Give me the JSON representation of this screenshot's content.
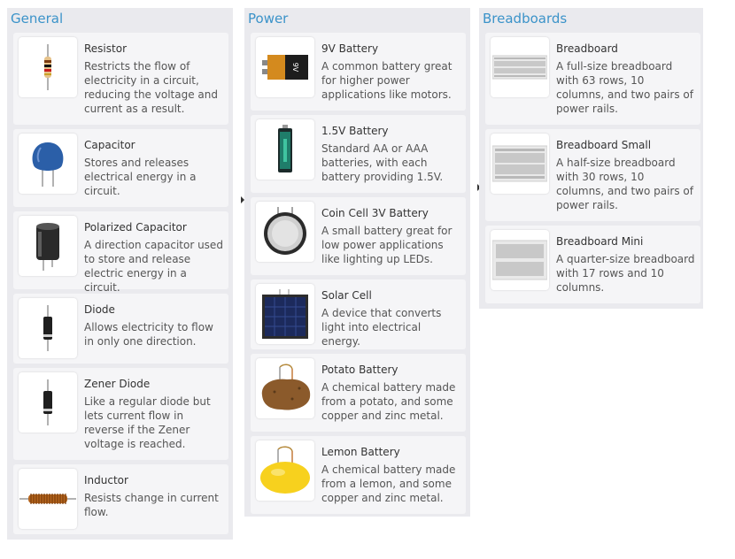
{
  "general": {
    "title": "General",
    "items": [
      {
        "icon": "resistor-icon",
        "title": "Resistor",
        "desc": "Restricts the flow of electricity in a circuit, reducing the voltage and current as a result."
      },
      {
        "icon": "capacitor-icon",
        "title": "Capacitor",
        "desc": "Stores and releases electrical energy in a circuit."
      },
      {
        "icon": "polarized-capacitor-icon",
        "title": "Polarized Capacitor",
        "desc": "A direction capacitor used to store and release electric energy in a circuit."
      },
      {
        "icon": "diode-icon",
        "title": "Diode",
        "desc": "Allows electricity to flow in only one direction."
      },
      {
        "icon": "zener-diode-icon",
        "title": "Zener Diode",
        "desc": "Like a regular diode but lets current flow in reverse if the Zener voltage is reached."
      },
      {
        "icon": "inductor-icon",
        "title": "Inductor",
        "desc": "Resists change in current flow."
      }
    ]
  },
  "power": {
    "title": "Power",
    "items": [
      {
        "icon": "9v-battery-icon",
        "title": "9V Battery",
        "desc": "A common battery great for higher power applications like motors."
      },
      {
        "icon": "aa-battery-icon",
        "title": "1.5V Battery",
        "desc": "Standard AA or AAA batteries, with each battery providing 1.5V."
      },
      {
        "icon": "coin-cell-icon",
        "title": "Coin Cell 3V Battery",
        "desc": "A small battery great for low power applications like lighting up LEDs."
      },
      {
        "icon": "solar-cell-icon",
        "title": "Solar Cell",
        "desc": "A device that converts light into electrical energy."
      },
      {
        "icon": "potato-battery-icon",
        "title": "Potato Battery",
        "desc": "A chemical battery made from a potato, and some copper and zinc metal."
      },
      {
        "icon": "lemon-battery-icon",
        "title": "Lemon Battery",
        "desc": "A chemical battery made from a lemon, and some copper and zinc metal."
      }
    ]
  },
  "breadboards": {
    "title": "Breadboards",
    "items": [
      {
        "icon": "breadboard-icon",
        "title": "Breadboard",
        "desc": "A full-size breadboard with 63 rows, 10 columns, and two pairs of power rails."
      },
      {
        "icon": "breadboard-small-icon",
        "title": "Breadboard Small",
        "desc": "A half-size breadboard with 30 rows, 10 columns, and two pairs of power rails."
      },
      {
        "icon": "breadboard-mini-icon",
        "title": "Breadboard Mini",
        "desc": "A quarter-size breadboard with 17 rows and 10 columns."
      }
    ]
  },
  "colors": {
    "panel_bg": "#eaeaee",
    "card_bg": "#f5f5f7",
    "title_accent": "#3b93c9"
  }
}
